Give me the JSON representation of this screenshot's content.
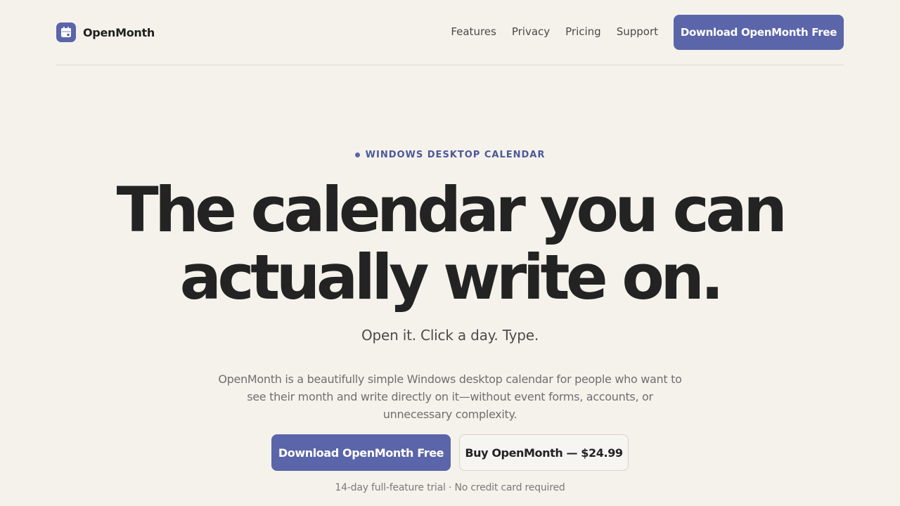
{
  "nav": {
    "brand": "OpenMonth",
    "logo_icon": "calendar-icon",
    "links": [
      "Features",
      "Privacy",
      "Pricing",
      "Support"
    ],
    "cta_label": "Download OpenMonth Free"
  },
  "hero": {
    "eyebrow": "WINDOWS DESKTOP CALENDAR",
    "headline_line1": "The calendar you can",
    "headline_line2": "actually write on.",
    "tagline": "Open it. Click a day. Type.",
    "description": "OpenMonth is a beautifully simple Windows desktop calendar for people who want to see their month and write directly on it—without event forms, accounts, or unnecessary complexity.",
    "primary_cta": "Download OpenMonth Free",
    "secondary_cta": "Buy OpenMonth — $24.99",
    "fine_print": "14-day full-feature trial · No credit card required"
  },
  "colors": {
    "background": "#f5f2ec",
    "accent": "#5b65a9",
    "eyebrow_text": "#4d579a",
    "heading": "#232323"
  }
}
